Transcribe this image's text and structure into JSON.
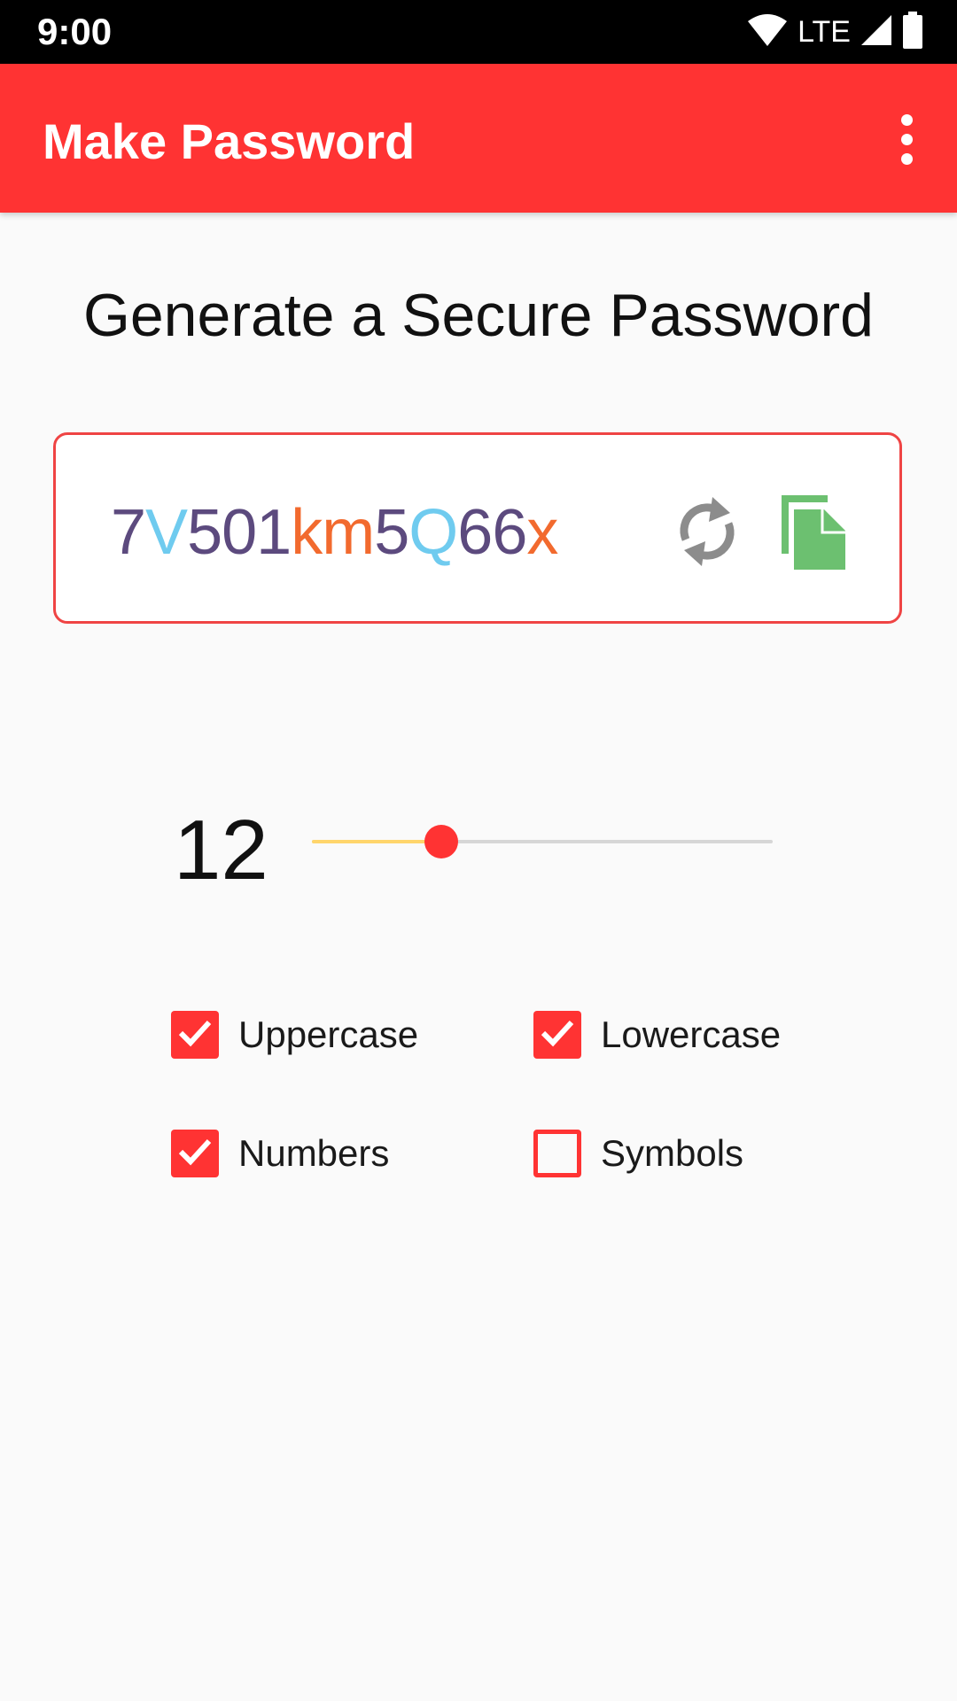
{
  "status_bar": {
    "time": "9:00",
    "network_label": "LTE"
  },
  "app_bar": {
    "title": "Make Password",
    "overflow_icon": "more-vert-icon"
  },
  "main": {
    "heading": "Generate a Secure Password",
    "password": {
      "characters": [
        {
          "char": "7",
          "color": "#5c4a7e"
        },
        {
          "char": "V",
          "color": "#6fcbef"
        },
        {
          "char": "5",
          "color": "#5c4a7e"
        },
        {
          "char": "0",
          "color": "#5c4a7e"
        },
        {
          "char": "1",
          "color": "#5c4a7e"
        },
        {
          "char": "k",
          "color": "#f26a2e"
        },
        {
          "char": "m",
          "color": "#f26a2e"
        },
        {
          "char": "5",
          "color": "#5c4a7e"
        },
        {
          "char": "Q",
          "color": "#6fcbef"
        },
        {
          "char": "6",
          "color": "#5c4a7e"
        },
        {
          "char": "6",
          "color": "#5c4a7e"
        },
        {
          "char": "x",
          "color": "#f26a2e"
        }
      ],
      "refresh_icon": "refresh-icon",
      "copy_icon": "copy-icon"
    },
    "length": {
      "value": "12",
      "slider_fraction": 0.28
    },
    "options": [
      {
        "label": "Uppercase",
        "checked": true
      },
      {
        "label": "Lowercase",
        "checked": true
      },
      {
        "label": "Numbers",
        "checked": true
      },
      {
        "label": "Symbols",
        "checked": false
      }
    ]
  },
  "colors": {
    "primary": "#ff3333",
    "status_bar": "#000000",
    "slider_fill": "#ffd56b",
    "copy_icon": "#6cc070",
    "refresh_icon": "#8c8c8c"
  }
}
